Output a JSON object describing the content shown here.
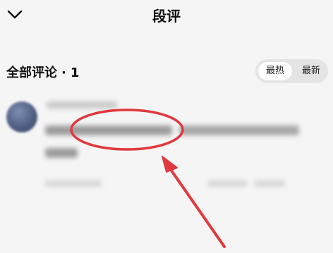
{
  "header": {
    "title": "段评",
    "back_icon": "chevron-down-icon"
  },
  "comments_section": {
    "title": "全部评论",
    "separator": "·",
    "count": "1",
    "sort": {
      "hot": "最热",
      "latest": "最新",
      "selected": "最热"
    }
  },
  "annotation": {
    "color": "#e0393e",
    "shapes": [
      "highlight-ellipse",
      "pointer-arrow"
    ]
  }
}
